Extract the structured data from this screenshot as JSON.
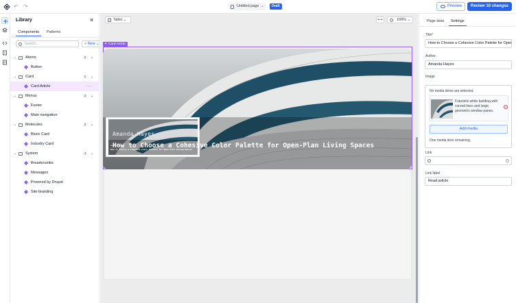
{
  "topbar": {
    "page_name": "Untitled page",
    "draft_badge": "Draft",
    "preview_label": "Preview",
    "review_label": "Review 10 changes"
  },
  "rail": {
    "icons": [
      "add-icon",
      "layers-icon",
      "code-icon",
      "library-icon",
      "pages-icon"
    ]
  },
  "library": {
    "title": "Library",
    "tabs": [
      "Components",
      "Patterns"
    ],
    "search_placeholder": "Search...",
    "new_label": "New",
    "groups": [
      {
        "label": "Atoms",
        "count": "2",
        "items": [
          "Button"
        ]
      },
      {
        "label": "Card",
        "count": "1",
        "items": [
          "Card Article"
        ]
      },
      {
        "label": "Menus",
        "count": "2",
        "items": [
          "Footer",
          "Main navigation"
        ]
      },
      {
        "label": "Molecules",
        "count": "2",
        "items": [
          "Basic Card",
          "Industry Card"
        ]
      },
      {
        "label": "System",
        "count": "4",
        "items": [
          "Breadcrumbs",
          "Messages",
          "Powered by Drupal",
          "Site branding"
        ]
      }
    ]
  },
  "canvas": {
    "viewport_label": "Tablet",
    "zoom_label": "100%",
    "selection_tag": "Card Article",
    "card": {
      "author": "Amanda Hayes",
      "title": "How to Choose a Cohesive Color Palette for Open-Plan Living Spaces"
    }
  },
  "panel": {
    "tabs": [
      "Page data",
      "Settings"
    ],
    "title_label": "Title*",
    "title_value": "How to Choose a Cohesive Color Palette for Open-Plan Living Spaces",
    "author_label": "Author",
    "author_value": "Amanda Hayes",
    "image_label": "Image",
    "media_note": "No media items are selected.",
    "media_desc": "Futuristic white building with curved lines and large, geometric window panes.",
    "add_media_label": "Add media",
    "remaining": "One media item remaining.",
    "link_label": "Link",
    "link_label_label": "Link label",
    "link_label_value": "Read article"
  },
  "colors": {
    "accent": "#2563eb",
    "component": "#8b5cf6",
    "selected_row": "#f3e8ff"
  }
}
